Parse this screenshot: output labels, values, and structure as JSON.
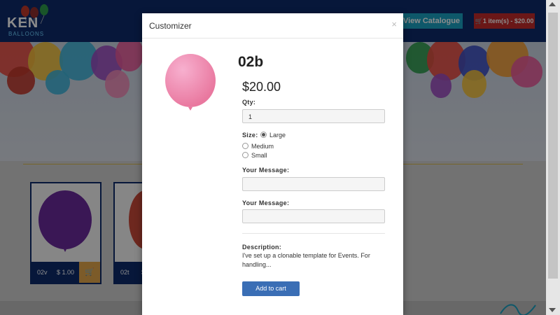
{
  "header": {
    "logo_text": "KEN",
    "logo_sub": "BALLOONS",
    "catalogue_button": "View Catalogue",
    "cart_button": "1 item(s) - $20.00"
  },
  "products": [
    {
      "code": "02v",
      "price": "$ 1.00"
    },
    {
      "code": "02t",
      "price": "$"
    }
  ],
  "modal": {
    "title": "Customizer",
    "close": "×",
    "product_name": "02b",
    "price": "$20.00",
    "qty_label": "Qty:",
    "qty_value": "1",
    "size_label": "Size:",
    "size_options": [
      "Large",
      "Medium",
      "Small"
    ],
    "size_selected": "Large",
    "message_label_1": "Your Message:",
    "message_label_2": "Your Message:",
    "description_label": "Description:",
    "description_text": "I've set up a clonable template for Events. For handling...",
    "add_to_cart": "Add to cart"
  },
  "colors": {
    "navy": "#0d2b6b",
    "cyan": "#1aa0c2",
    "red": "#c12a2a",
    "gold": "#e2a64b",
    "blue_button": "#3a6eb5",
    "balloon_pink": "#f08bb7"
  },
  "icons": {
    "cart": "cart-icon",
    "close": "close-icon"
  }
}
